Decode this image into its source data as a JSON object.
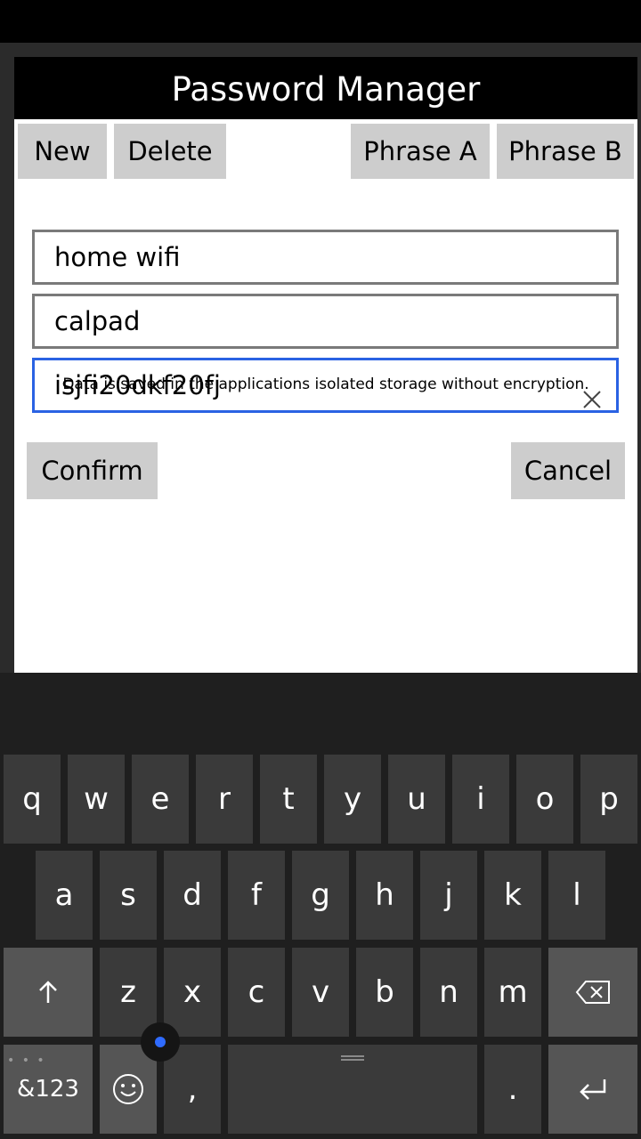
{
  "app": {
    "title": "Password Manager"
  },
  "toolbar": {
    "new_label": "New",
    "delete_label": "Delete",
    "phrase_a_label": "Phrase A",
    "phrase_b_label": "Phrase B"
  },
  "fields": {
    "name_value": "home wifi",
    "user_value": "calpad",
    "password_value": "isjfi20dkf20fj"
  },
  "note": "Data is saved in the applications isolated storage without encryption.",
  "actions": {
    "confirm_label": "Confirm",
    "cancel_label": "Cancel"
  },
  "keyboard": {
    "row1": [
      "q",
      "w",
      "e",
      "r",
      "t",
      "y",
      "u",
      "i",
      "o",
      "p"
    ],
    "row2": [
      "a",
      "s",
      "d",
      "f",
      "g",
      "h",
      "j",
      "k",
      "l"
    ],
    "row3": [
      "z",
      "x",
      "c",
      "v",
      "b",
      "n",
      "m"
    ],
    "symbols_label": "&123",
    "comma": ",",
    "period": ".",
    "dots": "• • •"
  },
  "colors": {
    "focus_border": "#2a62e3",
    "button_bg": "#cdcdcd",
    "accent_dot": "#2f6bff"
  }
}
